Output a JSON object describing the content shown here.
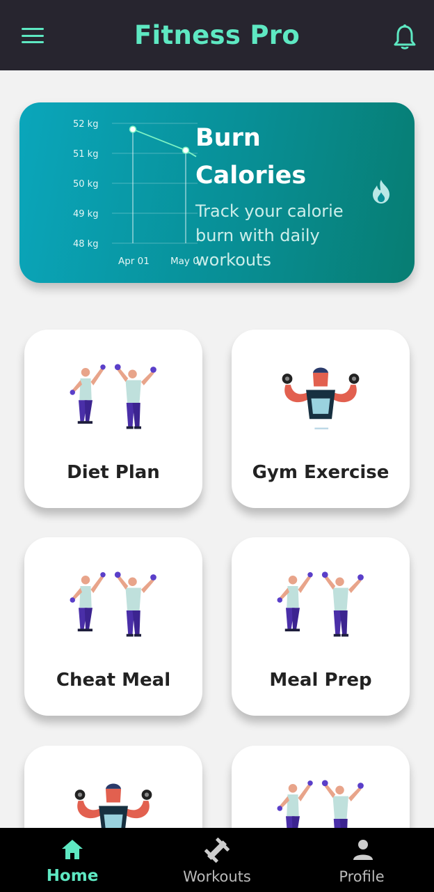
{
  "app": {
    "title": "Fitness Pro"
  },
  "colors": {
    "accent": "#5ee8c2",
    "appbar": "#27252f",
    "banner_start": "#0aa6bb",
    "banner_end": "#077d72"
  },
  "icons": {
    "menu": "menu-icon",
    "notifications": "bell-icon",
    "banner": "fire-icon"
  },
  "banner": {
    "title": "Burn Calories",
    "subtitle": "Track your calorie burn with daily workouts"
  },
  "chart_data": {
    "type": "line",
    "x": [
      "Apr 01",
      "May 0"
    ],
    "values": [
      51.8,
      51.1
    ],
    "y_ticks": [
      "52 kg",
      "51 kg",
      "50 kg",
      "49 kg",
      "48 kg"
    ],
    "ylim": [
      48,
      52
    ],
    "grid": true
  },
  "cards": [
    {
      "label": "Diet Plan",
      "illustration": "two-people-dumbbells"
    },
    {
      "label": "Gym Exercise",
      "illustration": "muscle-man-dumbbells"
    },
    {
      "label": "Cheat Meal",
      "illustration": "two-people-dumbbells"
    },
    {
      "label": "Meal Prep",
      "illustration": "two-people-dumbbells"
    },
    {
      "label": "",
      "illustration": "muscle-man-dumbbells"
    },
    {
      "label": "",
      "illustration": "two-people-dumbbells"
    }
  ],
  "nav": [
    {
      "label": "Home",
      "icon": "home-icon",
      "active": true
    },
    {
      "label": "Workouts",
      "icon": "dumbbell-icon",
      "active": false
    },
    {
      "label": "Profile",
      "icon": "person-icon",
      "active": false
    }
  ]
}
